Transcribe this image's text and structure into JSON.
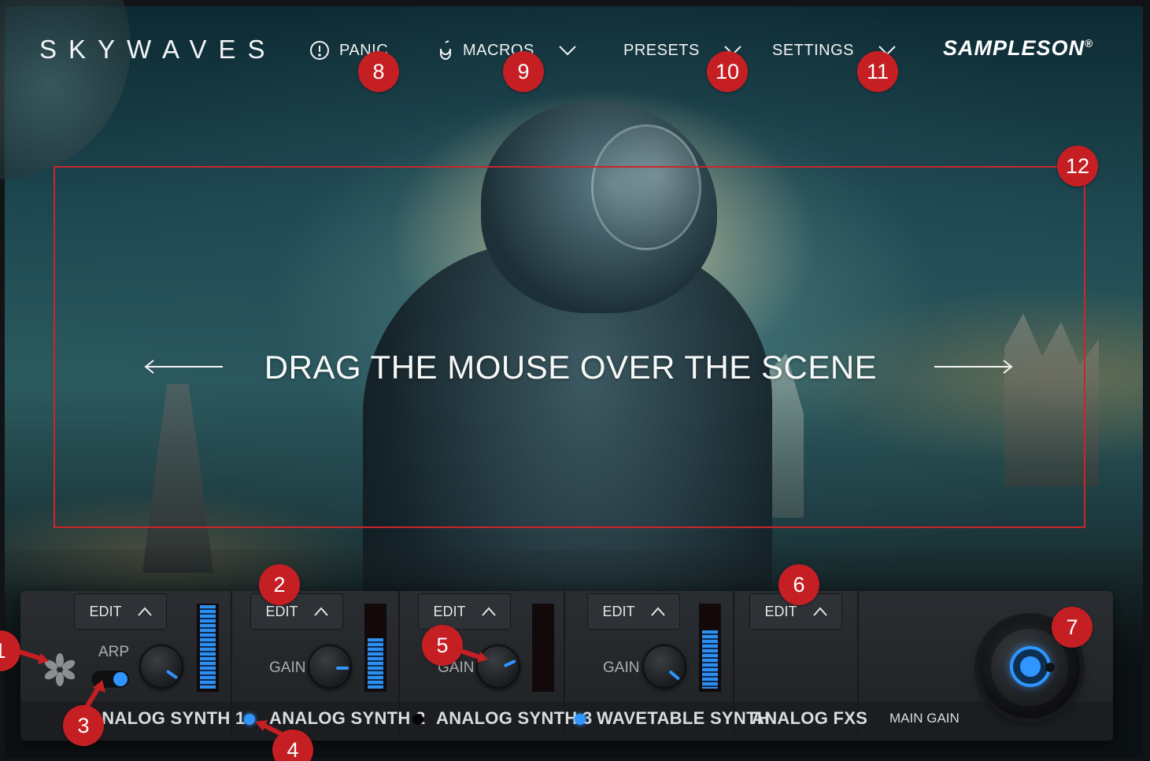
{
  "header": {
    "brand": "SKYWAVES",
    "nav": {
      "panic": "PANIC",
      "macros": "MACROS",
      "presets": "PRESETS",
      "settings": "SETTINGS"
    },
    "logo": "SAMPLESON",
    "logo_mark": "®"
  },
  "scene": {
    "hint": "DRAG THE MOUSE OVER THE SCENE"
  },
  "panel": {
    "channels": [
      {
        "edit_label": "EDIT",
        "knob_label": "ARP",
        "name": "ANALOG SYNTH 1",
        "meter_level": 1.0
      },
      {
        "edit_label": "EDIT",
        "knob_label": "GAIN",
        "name": "ANALOG SYNTH 2",
        "meter_level": 0.6,
        "active": true
      },
      {
        "edit_label": "EDIT",
        "knob_label": "GAIN",
        "name": "ANALOG SYNTH 3",
        "meter_level": 0.0,
        "active": false
      },
      {
        "edit_label": "EDIT",
        "knob_label": "GAIN",
        "name": "WAVETABLE SYNTH",
        "meter_level": 0.7,
        "active": true
      },
      {
        "edit_label": "EDIT",
        "name": "ANALOG FXS"
      }
    ],
    "main_gain_label": "MAIN GAIN",
    "accent_color": "#2f95ff"
  },
  "callouts": [
    "1",
    "2",
    "3",
    "4",
    "5",
    "6",
    "7",
    "8",
    "9",
    "10",
    "11",
    "12"
  ],
  "annotation_color": "#c51f24"
}
